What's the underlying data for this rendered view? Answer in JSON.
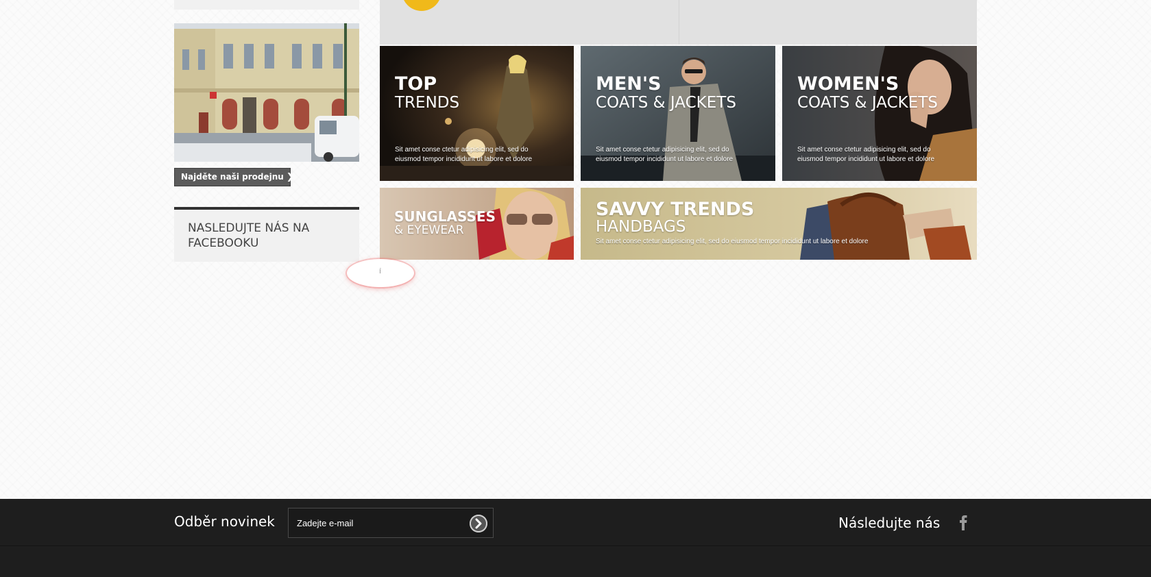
{
  "sidebar": {
    "find_store_label": "Najděte naši prodejnu",
    "follow_box_title": "NASLEDUJTE NÁS NA FACEBOOKU"
  },
  "tiles": {
    "top_trends": {
      "title": "TOP",
      "subtitle": "TRENDS",
      "description": "Sit amet conse ctetur adipisicing elit, sed do eiusmod tempor incididunt ut labore et dolore"
    },
    "mens": {
      "title": "MEN'S",
      "subtitle": "COATS & JACKETS",
      "description": "Sit amet conse ctetur adipisicing elit, sed do eiusmod tempor incididunt ut labore et dolore"
    },
    "womens": {
      "title": "WOMEN'S",
      "subtitle": "COATS & JACKETS",
      "description": "Sit amet conse ctetur adipisicing elit, sed do eiusmod tempor incididunt ut labore et dolore"
    },
    "sunglasses": {
      "title": "SUNGLASSES",
      "subtitle": "& EYEWEAR"
    },
    "handbags": {
      "title": "SAVVY TRENDS",
      "subtitle": "HANDBAGS",
      "description": "Sit amet conse ctetur adipisicing elit, sed do eiusmod tempor incididunt ut labore et dolore"
    }
  },
  "bubble": {
    "text": "í"
  },
  "footer": {
    "newsletter_label": "Odběr novinek",
    "email_placeholder": "Zadejte e-mail",
    "follow_label": "Následujte nás"
  },
  "icons": {
    "submit": "arrow-right-circle-icon",
    "facebook": "facebook-icon",
    "chevron": "chevron-right-icon"
  },
  "colors": {
    "accent_yellow": "#f0b91a",
    "footer_bg": "#1e1e1e",
    "button_bg": "#5b5b5b"
  }
}
